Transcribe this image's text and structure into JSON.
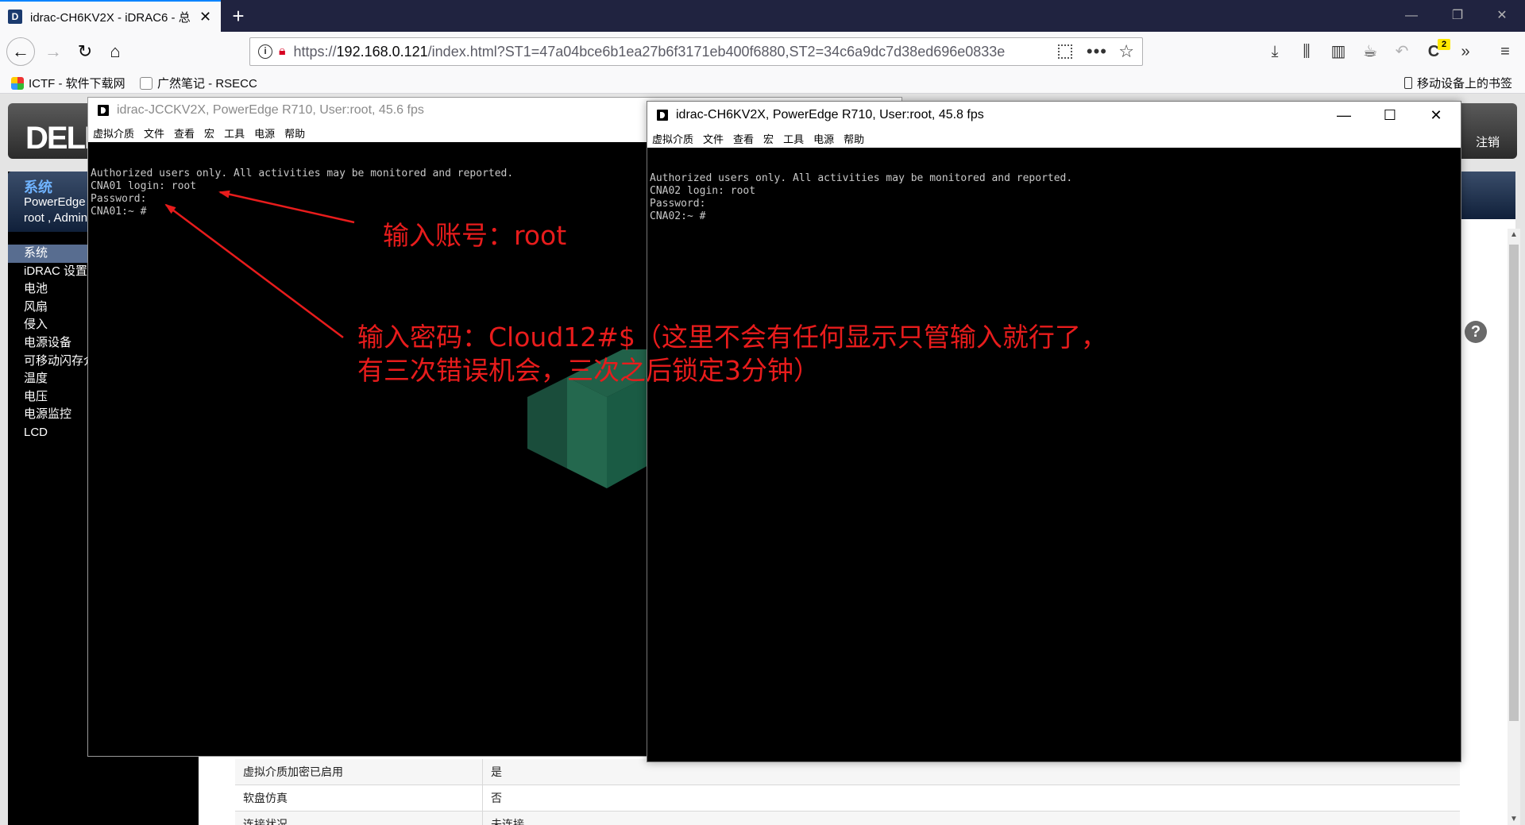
{
  "browser": {
    "tab_title": "idrac-CH6KV2X - iDRAC6 - 总",
    "url_prefix": "https://",
    "url_host": "192.168.0.121",
    "url_rest": "/index.html?ST1=47a04bce6b1ea27b6f3171eb400f6880,ST2=34c6a9dc7d38ed696e0833e",
    "badge_count": "2",
    "bookmarks": [
      {
        "label": "ICTF - 软件下载网"
      },
      {
        "label": "广然笔记 - RSECC"
      }
    ],
    "mobile_bookmarks": "移动设备上的书签"
  },
  "idrac": {
    "logo": "DELL",
    "logout": "注销",
    "system_title": "系统",
    "system_model": "PowerEdge",
    "user_line": "root , Admin",
    "nav_items": [
      {
        "label": "系统"
      },
      {
        "label": "iDRAC 设置"
      },
      {
        "label": "电池"
      },
      {
        "label": "风扇"
      },
      {
        "label": "侵入"
      },
      {
        "label": "电源设备"
      },
      {
        "label": "可移动闪存介质"
      },
      {
        "label": "温度"
      },
      {
        "label": "电压"
      },
      {
        "label": "电源监控"
      },
      {
        "label": "LCD"
      }
    ],
    "help_icon": "?",
    "table_rows": [
      {
        "key": "虚拟介质加密已启用",
        "value": "是"
      },
      {
        "key": "软盘仿真",
        "value": "否"
      },
      {
        "key": "连接状况",
        "value": "未连接"
      }
    ]
  },
  "console1": {
    "title": "idrac-JCCKV2X, PowerEdge R710, User:root, 45.6 fps",
    "menu": [
      "虚拟介质",
      "文件",
      "查看",
      "宏",
      "工具",
      "电源",
      "帮助"
    ],
    "lines": [
      "Authorized users only. All activities may be monitored and reported.",
      "CNA01 login: root",
      "Password:",
      "CNA01:~ #"
    ]
  },
  "console2": {
    "title": "idrac-CH6KV2X, PowerEdge R710, User:root, 45.8 fps",
    "menu": [
      "虚拟介质",
      "文件",
      "查看",
      "宏",
      "工具",
      "电源",
      "帮助"
    ],
    "lines": [
      "Authorized users only. All activities may be monitored and reported.",
      "CNA02 login: root",
      "Password:",
      "CNA02:~ #"
    ]
  },
  "annotations": {
    "account": "输入账号：root",
    "password_line1": "输入密码：Cloud12#$（这里不会有任何显示只管输入就行了，",
    "password_line2": "有三次错误机会，三次之后锁定3分钟）",
    "color": "#e81c1c"
  }
}
